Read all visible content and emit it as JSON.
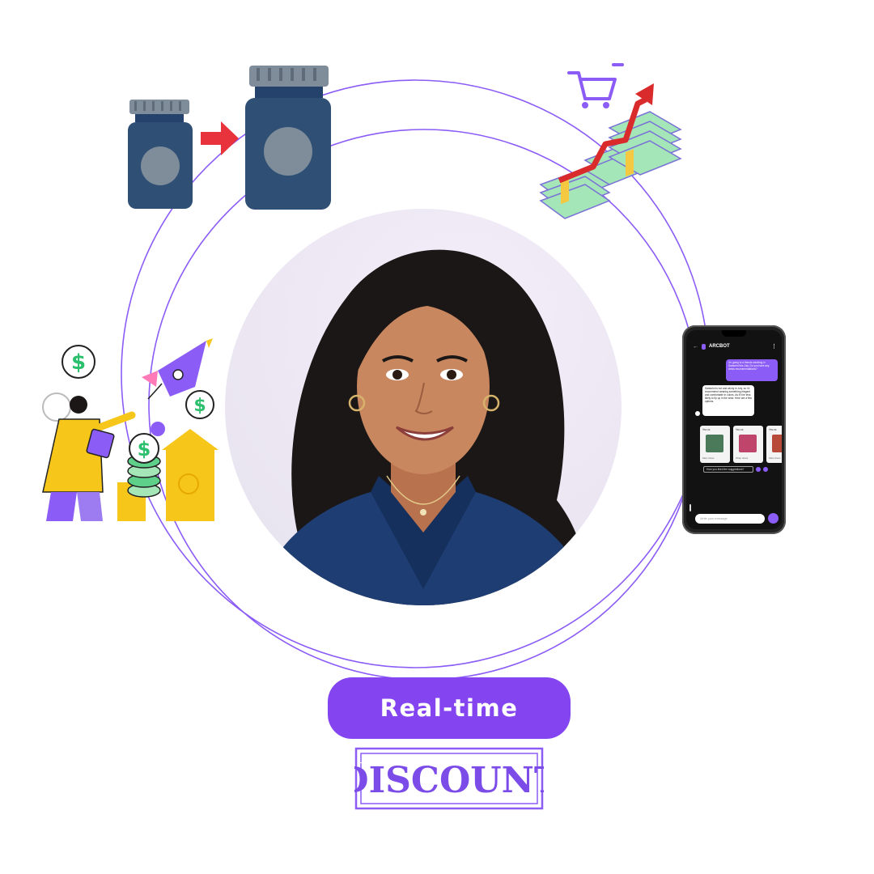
{
  "badge": {
    "label": "Real-time"
  },
  "stamp": {
    "text": "DISCOUNT"
  },
  "phone": {
    "app_name": "ARCBOT",
    "user_message": "I'm going to a friends wedding in Santorini this July. Do you have any dress recommendations?",
    "bot_message": "Santorini is hot and windy in July, so I'd recommend wearing something elegant and comfortable in colors. As it'll be less likely to fly up in the wind. Here are a few options.",
    "product_cards": [
      {
        "price": "₹54.99",
        "caption": "Maxi dress"
      },
      {
        "price": "₹60.99",
        "caption": "Wrap dress"
      },
      {
        "price": "₹59.99",
        "caption": "Maxi dress"
      }
    ],
    "followup": "How you liked the suggestions?",
    "input_placeholder": "Write your message"
  },
  "colors": {
    "accent": "#8444f0",
    "ring": "#8b5cf6",
    "bottle": "#2f4f75",
    "bottle_lid": "#7f8c9a",
    "arrow_red": "#e8323c",
    "money_green": "#a5e6b8",
    "person_yellow": "#f7c61b"
  },
  "illustrations": {
    "bottles": "small-to-large-bottle-icon",
    "growth": "cart-money-growth-icon",
    "business": "businessperson-rocket-coins-icon"
  }
}
